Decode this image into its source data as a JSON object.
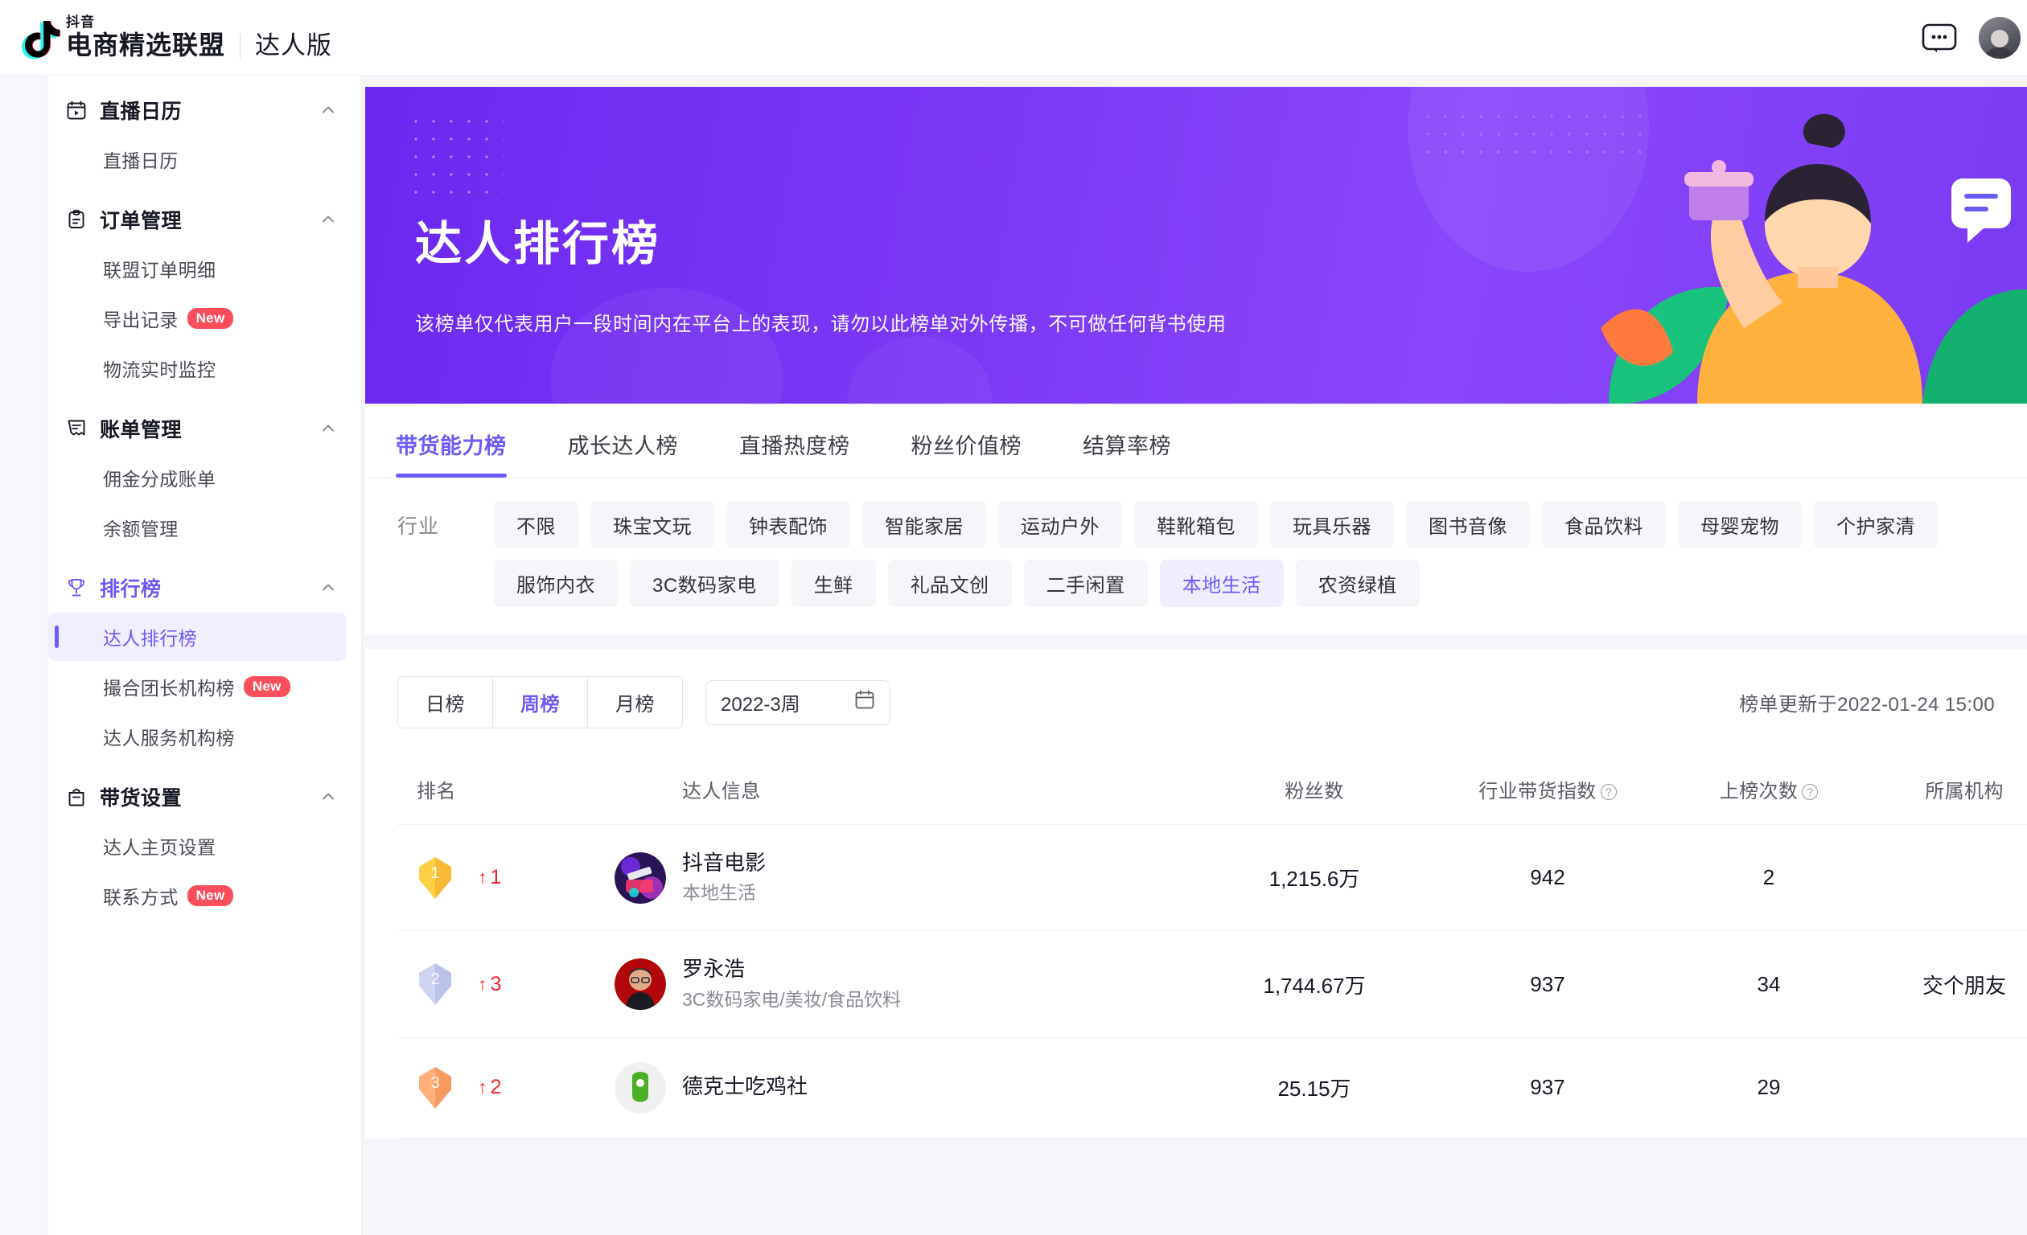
{
  "header": {
    "logo_small": "抖音",
    "brand": "电商精选联盟",
    "brand_sub": "达人版",
    "chat_icon": "chat-bubble-icon",
    "avatar": "user-avatar"
  },
  "sidebar": {
    "groups": [
      {
        "label": "直播日历",
        "icon": "calendar-play-icon",
        "active": false,
        "items": [
          {
            "label": "直播日历",
            "badge": "",
            "selected": false
          }
        ]
      },
      {
        "label": "订单管理",
        "icon": "clipboard-icon",
        "active": false,
        "items": [
          {
            "label": "联盟订单明细",
            "badge": "",
            "selected": false
          },
          {
            "label": "导出记录",
            "badge": "New",
            "selected": false
          },
          {
            "label": "物流实时监控",
            "badge": "",
            "selected": false
          }
        ]
      },
      {
        "label": "账单管理",
        "icon": "receipt-icon",
        "active": false,
        "items": [
          {
            "label": "佣金分成账单",
            "badge": "",
            "selected": false
          },
          {
            "label": "余额管理",
            "badge": "",
            "selected": false
          }
        ]
      },
      {
        "label": "排行榜",
        "icon": "trophy-icon",
        "active": true,
        "items": [
          {
            "label": "达人排行榜",
            "badge": "",
            "selected": true
          },
          {
            "label": "撮合团长机构榜",
            "badge": "New",
            "selected": false
          },
          {
            "label": "达人服务机构榜",
            "badge": "",
            "selected": false
          }
        ]
      },
      {
        "label": "带货设置",
        "icon": "bag-icon",
        "active": false,
        "items": [
          {
            "label": "达人主页设置",
            "badge": "",
            "selected": false
          },
          {
            "label": "联系方式",
            "badge": "New",
            "selected": false
          }
        ]
      }
    ]
  },
  "banner": {
    "title": "达人排行榜",
    "subtitle": "该榜单仅代表用户一段时间内在平台上的表现，请勿以此榜单对外传播，不可做任何背书使用"
  },
  "tabs": [
    {
      "label": "带货能力榜",
      "active": true
    },
    {
      "label": "成长达人榜",
      "active": false
    },
    {
      "label": "直播热度榜",
      "active": false
    },
    {
      "label": "粉丝价值榜",
      "active": false
    },
    {
      "label": "结算率榜",
      "active": false
    }
  ],
  "filter": {
    "label": "行业",
    "chips": [
      {
        "label": "不限",
        "selected": false
      },
      {
        "label": "珠宝文玩",
        "selected": false
      },
      {
        "label": "钟表配饰",
        "selected": false
      },
      {
        "label": "智能家居",
        "selected": false
      },
      {
        "label": "运动户外",
        "selected": false
      },
      {
        "label": "鞋靴箱包",
        "selected": false
      },
      {
        "label": "玩具乐器",
        "selected": false
      },
      {
        "label": "图书音像",
        "selected": false
      },
      {
        "label": "食品饮料",
        "selected": false
      },
      {
        "label": "母婴宠物",
        "selected": false
      },
      {
        "label": "个护家清",
        "selected": false
      },
      {
        "label": "服饰内衣",
        "selected": false
      },
      {
        "label": "3C数码家电",
        "selected": false
      },
      {
        "label": "生鲜",
        "selected": false
      },
      {
        "label": "礼品文创",
        "selected": false
      },
      {
        "label": "二手闲置",
        "selected": false
      },
      {
        "label": "本地生活",
        "selected": true
      },
      {
        "label": "农资绿植",
        "selected": false
      }
    ]
  },
  "controls": {
    "period_options": [
      {
        "label": "日榜",
        "active": false
      },
      {
        "label": "周榜",
        "active": true
      },
      {
        "label": "月榜",
        "active": false
      }
    ],
    "week_value": "2022-3周",
    "calendar_icon": "calendar-icon",
    "update_text": "榜单更新于2022-01-24 15:00"
  },
  "table": {
    "columns": [
      {
        "key": "rank",
        "label": "排名",
        "help": false
      },
      {
        "key": "info",
        "label": "达人信息",
        "help": false
      },
      {
        "key": "fans",
        "label": "粉丝数",
        "help": false
      },
      {
        "key": "index",
        "label": "行业带货指数",
        "help": true
      },
      {
        "key": "times",
        "label": "上榜次数",
        "help": true
      },
      {
        "key": "org",
        "label": "所属机构",
        "help": false
      }
    ],
    "rows": [
      {
        "rank": "1",
        "medal": "gold",
        "delta": "1",
        "delta_dir": "up",
        "name": "抖音电影",
        "categories": "本地生活",
        "avatar": "douyin-movie-avatar",
        "fans": "1,215.6万",
        "index": "942",
        "times": "2",
        "org": ""
      },
      {
        "rank": "2",
        "medal": "silver",
        "delta": "3",
        "delta_dir": "up",
        "name": "罗永浩",
        "categories": "3C数码家电/美妆/食品饮料",
        "avatar": "luoyonghao-avatar",
        "fans": "1,744.67万",
        "index": "937",
        "times": "34",
        "org": "交个朋友"
      },
      {
        "rank": "3",
        "medal": "bronze",
        "delta": "2",
        "delta_dir": "up",
        "name": "德克士吃鸡社",
        "categories": "",
        "avatar": "dicos-avatar",
        "fans": "25.15万",
        "index": "937",
        "times": "29",
        "org": ""
      }
    ]
  }
}
